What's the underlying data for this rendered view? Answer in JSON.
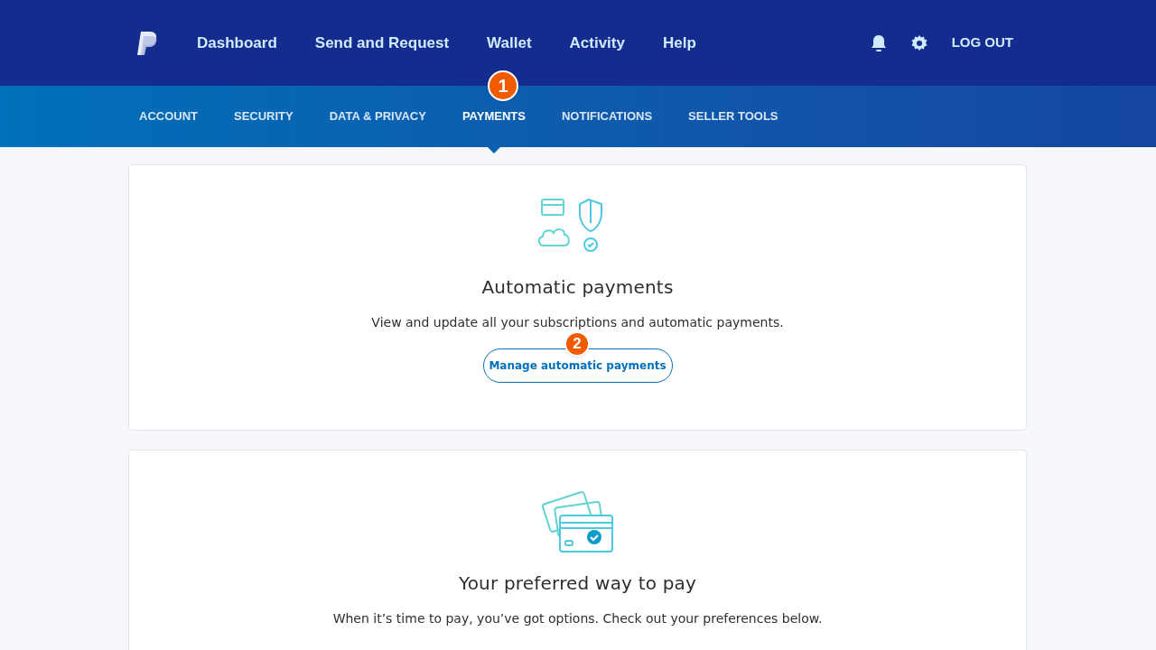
{
  "top_nav": {
    "items": [
      "Dashboard",
      "Send and Request",
      "Wallet",
      "Activity",
      "Help"
    ],
    "logout": "LOG OUT"
  },
  "sub_nav": [
    {
      "label": "ACCOUNT",
      "selected": false
    },
    {
      "label": "SECURITY",
      "selected": false
    },
    {
      "label": "DATA & PRIVACY",
      "selected": false
    },
    {
      "label": "PAYMENTS",
      "selected": true
    },
    {
      "label": "NOTIFICATIONS",
      "selected": false
    },
    {
      "label": "SELLER TOOLS",
      "selected": false
    }
  ],
  "cards": [
    {
      "kind": "cloud-shield",
      "title": "Automatic payments",
      "text": "View and update all your subscriptions and automatic payments.",
      "button": "Manage automatic payments"
    },
    {
      "kind": "cards",
      "title": "Your preferred way to pay",
      "text": "When it’s time to pay, you’ve got options. Check out your preferences below."
    }
  ],
  "callouts": [
    "1",
    "2"
  ]
}
